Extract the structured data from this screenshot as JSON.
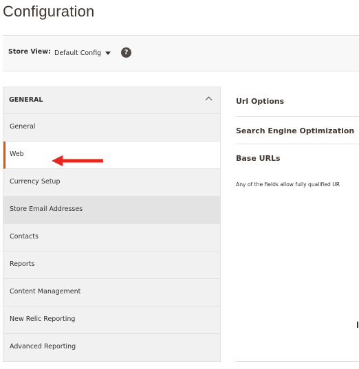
{
  "page": {
    "title": "Configuration"
  },
  "store_view": {
    "label": "Store View:",
    "selected": "Default Config",
    "help_icon": "help-icon",
    "help_glyph": "?"
  },
  "sidebar": {
    "group_label": "GENERAL",
    "group_icon": "chevron-up-icon",
    "items": [
      {
        "label": "General"
      },
      {
        "label": "Web"
      },
      {
        "label": "Currency Setup"
      },
      {
        "label": "Store Email Addresses"
      },
      {
        "label": "Contacts"
      },
      {
        "label": "Reports"
      },
      {
        "label": "Content Management"
      },
      {
        "label": "New Relic Reporting"
      },
      {
        "label": "Advanced Reporting"
      }
    ],
    "active_index": 1,
    "highlighted_index": 3
  },
  "content": {
    "sections": [
      {
        "label": "Url Options"
      },
      {
        "label": "Search Engine Optimization"
      },
      {
        "label": "Base URLs"
      }
    ],
    "note": "Any of the fields allow fully qualified UR"
  },
  "colors": {
    "accent": "#eb5202",
    "arrow": "#e8281e",
    "sidebar_bg": "#f1f1f1",
    "highlight_bg": "#e3e3e3"
  }
}
